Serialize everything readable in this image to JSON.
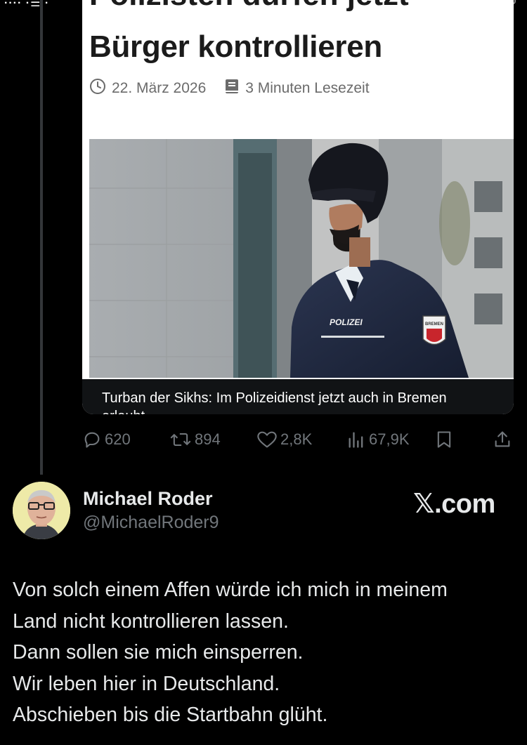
{
  "status_bar": {
    "left": "···· ·☰ ·",
    "center": "·· ··"
  },
  "article": {
    "headline_line1": "Polizisten dürfen jetzt",
    "headline_line2": "Bürger kontrollieren",
    "date": "22. März 2026",
    "read_time": "3 Minuten Lesezeit",
    "image_labels": {
      "uniform": "POLIZEI",
      "badge": "BREMEN"
    },
    "caption": "Turban der Sikhs: Im Polizeidienst jetzt auch in Bremen",
    "caption_tail": "erlaubt"
  },
  "actions": {
    "replies": "620",
    "reposts": "894",
    "likes": "2,8K",
    "views": "67,9K"
  },
  "author": {
    "name": "Michael Roder",
    "handle": "@MichaelRoder9",
    "brand": "𝕏.com"
  },
  "tweet": {
    "lines": [
      "Von solch einem Affen würde ich mich in meinem",
      "Land nicht kontrollieren lassen.",
      "Dann sollen sie mich einsperren.",
      "Wir leben hier in Deutschland.",
      "Abschieben bis die Startbahn glüht."
    ]
  },
  "colors": {
    "background": "#000000",
    "text": "#e7e9ea",
    "muted": "#71767b",
    "thread_line": "#333639"
  },
  "icons": [
    "clock-icon",
    "book-icon",
    "reply-icon",
    "repost-icon",
    "like-icon",
    "views-icon",
    "bookmark-icon",
    "share-icon"
  ]
}
